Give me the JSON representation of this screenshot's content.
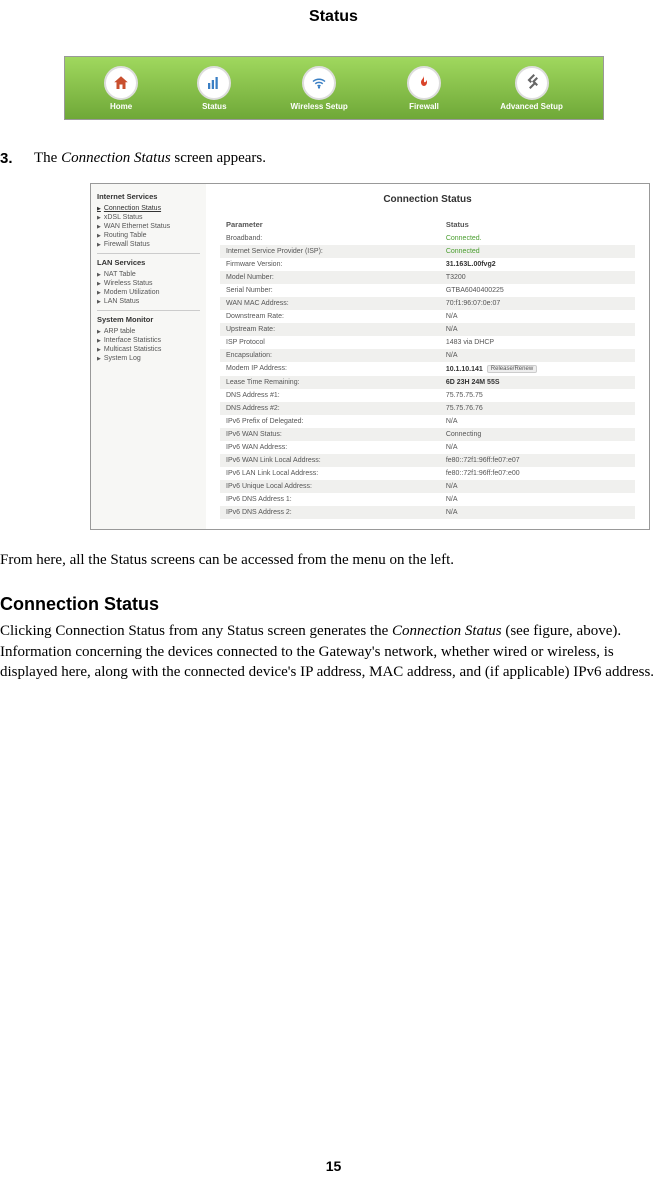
{
  "header": {
    "title": "Status"
  },
  "nav": {
    "items": [
      {
        "label": "Home",
        "icon": "home-icon"
      },
      {
        "label": "Status",
        "icon": "status-icon"
      },
      {
        "label": "Wireless Setup",
        "icon": "wifi-icon"
      },
      {
        "label": "Firewall",
        "icon": "firewall-icon"
      },
      {
        "label": "Advanced Setup",
        "icon": "tools-icon"
      }
    ]
  },
  "step": {
    "number": "3.",
    "prefix": "The ",
    "screen_name": "Connection Status",
    "suffix": " screen appears."
  },
  "screenshot": {
    "sidebar": {
      "groups": [
        {
          "title": "Internet Services",
          "items": [
            "Connection Status",
            "xDSL Status",
            "WAN Ethernet Status",
            "Routing Table",
            "Firewall Status"
          ]
        },
        {
          "title": "LAN Services",
          "items": [
            "NAT Table",
            "Wireless Status",
            "Modem Utilization",
            "LAN Status"
          ]
        },
        {
          "title": "System Monitor",
          "items": [
            "ARP table",
            "Interface Statistics",
            "Multicast Statistics",
            "System Log"
          ]
        }
      ]
    },
    "content": {
      "title": "Connection Status",
      "header": {
        "param": "Parameter",
        "status": "Status"
      },
      "rows": [
        {
          "param": "Broadband:",
          "status": "Connected.",
          "green": true
        },
        {
          "param": "Internet Service Provider (ISP):",
          "status": "Connected",
          "green": true
        },
        {
          "param": "Firmware Version:",
          "status": "31.163L.00fvg2",
          "bold": true
        },
        {
          "param": "Model Number:",
          "status": "T3200"
        },
        {
          "param": "Serial Number:",
          "status": "GTBA6040400225"
        },
        {
          "param": "WAN MAC Address:",
          "status": "70:f1:96:07:0e:07"
        },
        {
          "param": "Downstream Rate:",
          "status": "N/A"
        },
        {
          "param": "Upstream Rate:",
          "status": "N/A"
        },
        {
          "param": "ISP Protocol",
          "status": "1483 via DHCP"
        },
        {
          "param": "Encapsulation:",
          "status": "N/A"
        },
        {
          "param": "Modem IP Address:",
          "status": "10.1.10.141",
          "bold": true,
          "button": "Release/Renew"
        },
        {
          "param": "Lease Time Remaining:",
          "status": "6D 23H 24M 55S",
          "bold": true
        },
        {
          "param": "DNS Address #1:",
          "status": "75.75.75.75"
        },
        {
          "param": "DNS Address #2:",
          "status": "75.75.76.76"
        },
        {
          "param": "IPv6 Prefix of Delegated:",
          "status": "N/A"
        },
        {
          "param": "IPv6 WAN Status:",
          "status": "Connecting"
        },
        {
          "param": "IPv6 WAN Address:",
          "status": "N/A"
        },
        {
          "param": "IPv6 WAN Link Local Address:",
          "status": "fe80::72f1:96ff:fe07:e07"
        },
        {
          "param": "IPv6 LAN Link Local Address:",
          "status": "fe80::72f1:96ff:fe07:e00"
        },
        {
          "param": "IPv6 Unique Local Address:",
          "status": "N/A"
        },
        {
          "param": "IPv6 DNS Address 1:",
          "status": "N/A"
        },
        {
          "param": "IPv6 DNS Address 2:",
          "status": "N/A"
        }
      ]
    }
  },
  "paragraph1": "From here, all the Status screens can be accessed from the menu on the left.",
  "section": {
    "heading": "Connection Status",
    "body_prefix": "Clicking Connection Status from any Status screen generates the ",
    "body_italic": "Connection Status",
    "body_suffix": " (see figure, above). Information concerning the devices connected to the Gateway's network, whether wired or wireless, is displayed here, along with the connected device's IP address, MAC address, and (if applicable) IPv6 address."
  },
  "footer": {
    "page_number": "15"
  }
}
